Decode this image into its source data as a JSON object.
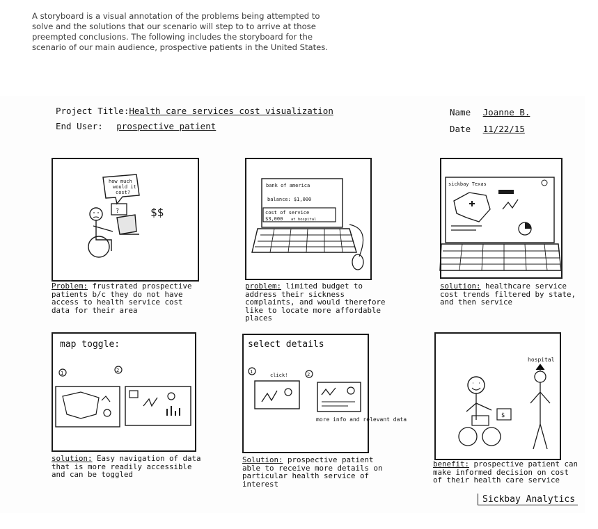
{
  "intro": "A storyboard is a visual annotation of the problems being attempted to solve and the solutions that our scenario will step to to arrive at those preempted conclusions. The following includes the storyboard for the scenario of our main audience, prospective patients in the United States.",
  "header": {
    "project_title_label": "Project Title:",
    "project_title_value": "Health care services cost visualization",
    "end_user_label": "End User:",
    "end_user_value": "prospective patient",
    "name_label": "Name",
    "name_value": "Joanne B.",
    "date_label": "Date",
    "date_value": "11/22/15"
  },
  "panels": [
    {
      "caption_lead": "Problem:",
      "caption_rest": " frustrated prospective patients b/c they do not have access to health service cost data for their area",
      "drawing": {
        "bubble_text": "how much would it cost?",
        "money_marks": "$$"
      }
    },
    {
      "caption_lead": "problem:",
      "caption_rest": " limited budget to address their sickness complaints, and would therefore like to locate more affordable places",
      "drawing": {
        "bank_name": "bank of america",
        "balance": "balance: $1,000",
        "cost_label": "cost of service",
        "cost_value": "$3,000",
        "cost_note": "at hospital"
      }
    },
    {
      "caption_lead": "solution:",
      "caption_rest": " healthcare service cost trends filtered by state, and then service",
      "drawing": {
        "map_label": "sickbay Texas"
      }
    },
    {
      "title": "map toggle:",
      "caption_lead": "solution:",
      "caption_rest": " Easy navigation of data that is more readily accessible and can be toggled",
      "drawing": {
        "marker_1": "1",
        "marker_2": "2"
      }
    },
    {
      "title": "select details",
      "caption_lead": "Solution:",
      "caption_rest": " prospective patient able to receive more details on particular health service of interest",
      "drawing": {
        "marker_1": "1",
        "marker_2": "2",
        "click_label": "click!",
        "note": "more info and relevant data"
      }
    },
    {
      "caption_lead": "benefit:",
      "caption_rest": " prospective patient can make informed decision on cost of their health care service",
      "drawing": {
        "hospital_label": "hospital",
        "money_mark": "$"
      }
    }
  ],
  "signature": "Sickbay Analytics"
}
